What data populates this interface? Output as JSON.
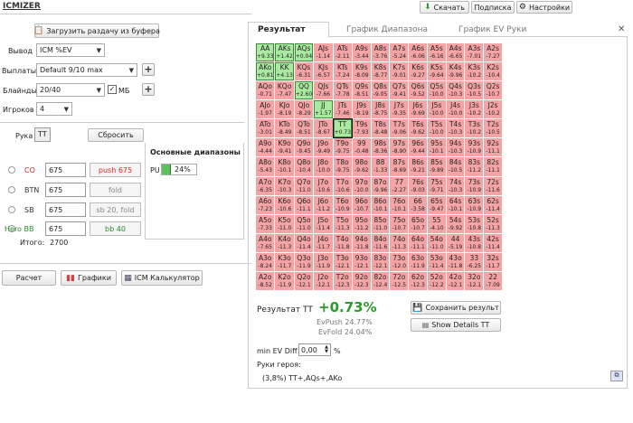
{
  "app": {
    "title": "ICMIZER"
  },
  "top_buttons": {
    "download": "Скачать",
    "subscribe": "Подписка",
    "settings": "Настройки"
  },
  "load_button": "Загрузить раздачу из буфера",
  "form": {
    "output_label": "Вывод",
    "output_value": "ICM %EV",
    "payouts_label": "Выплаты",
    "payouts_value": "Default 9/10 max",
    "blinds_label": "Блайнды",
    "blinds_value": "20/40",
    "mb_label": "МБ",
    "players_label": "Игроков",
    "players_value": "4"
  },
  "hand": {
    "label": "Рука",
    "value": "TT",
    "reset": "Сбросить"
  },
  "ranges": {
    "title": "Основные диапазоны",
    "pu_label": "PU",
    "pu_value": "24%"
  },
  "players": [
    {
      "pos": "CO",
      "stack": "675",
      "action": "push 675",
      "color": "#d22",
      "action_color": "#d22"
    },
    {
      "pos": "BTN",
      "stack": "675",
      "action": "fold",
      "color": "#333",
      "action_color": "#888"
    },
    {
      "pos": "SB",
      "stack": "675",
      "action": "sb 20, fold",
      "color": "#333",
      "action_color": "#888"
    },
    {
      "pos": "Hero BB",
      "stack": "675",
      "action": "bb 40",
      "color": "#2a8a2a",
      "action_color": "#2a8a2a"
    }
  ],
  "total": {
    "label": "Итого:",
    "value": "2700"
  },
  "bottom_buttons": {
    "calc": "Расчет",
    "charts": "Графики",
    "icm_calc": "ICM Калькулятор"
  },
  "tabs": [
    "Результат",
    "График Диапазона",
    "График EV Руки"
  ],
  "result": {
    "label": "Результат TT",
    "value": "+0.73%",
    "evpush": "EvPush 24.77%",
    "evfold": "EvFold 24.04%",
    "save": "Сохранить результ",
    "details": "Show Details TT",
    "min_ev_label": "min EV Diff",
    "min_ev_value": "0,00",
    "pct": "%",
    "hero_hands_label": "Руки героя:",
    "hero_hands": "(3,8%) TT+,AQs+,AKo"
  },
  "matrix": [
    [
      [
        "AA",
        "+9.33"
      ],
      [
        "AKs",
        "+1.42"
      ],
      [
        "AQs",
        "+0.04"
      ],
      [
        "AJs",
        "-1.14"
      ],
      [
        "ATs",
        "-2.11"
      ],
      [
        "A9s",
        "-3.44"
      ],
      [
        "A8s",
        "-3.76"
      ],
      [
        "A7s",
        "-5.24"
      ],
      [
        "A6s",
        "-6.06"
      ],
      [
        "A5s",
        "-6.16"
      ],
      [
        "A4s",
        "-6.65"
      ],
      [
        "A3s",
        "-7.01"
      ],
      [
        "A2s",
        "-7.27"
      ]
    ],
    [
      [
        "AKo",
        "+0.81"
      ],
      [
        "KK",
        "+4.13"
      ],
      [
        "KQs",
        "-6.31"
      ],
      [
        "KJs",
        "-6.57"
      ],
      [
        "KTs",
        "-7.24"
      ],
      [
        "K9s",
        "-8.09"
      ],
      [
        "K8s",
        "-8.77"
      ],
      [
        "K7s",
        "-9.01"
      ],
      [
        "K6s",
        "-9.27"
      ],
      [
        "K5s",
        "-9.64"
      ],
      [
        "K4s",
        "-9.96"
      ],
      [
        "K3s",
        "-10.2"
      ],
      [
        "K2s",
        "-10.4"
      ]
    ],
    [
      [
        "AQo",
        "-0.71"
      ],
      [
        "KQo",
        "-7.47"
      ],
      [
        "QQ",
        "+2.60"
      ],
      [
        "QJs",
        "-7.66"
      ],
      [
        "QTs",
        "-7.78"
      ],
      [
        "Q9s",
        "-8.51"
      ],
      [
        "Q8s",
        "-9.05"
      ],
      [
        "Q7s",
        "-9.41"
      ],
      [
        "Q6s",
        "-9.52"
      ],
      [
        "Q5s",
        "-10.0"
      ],
      [
        "Q4s",
        "-10.3"
      ],
      [
        "Q3s",
        "-10.5"
      ],
      [
        "Q2s",
        "-10.7"
      ]
    ],
    [
      [
        "AJo",
        "-1.97"
      ],
      [
        "KJo",
        "-8.19"
      ],
      [
        "QJo",
        "-8.29"
      ],
      [
        "JJ",
        "+1.57"
      ],
      [
        "JTs",
        "-7.46"
      ],
      [
        "J9s",
        "-8.19"
      ],
      [
        "J8s",
        "-8.75"
      ],
      [
        "J7s",
        "-9.35"
      ],
      [
        "J6s",
        "-9.69"
      ],
      [
        "J5s",
        "-10.0"
      ],
      [
        "J4s",
        "-10.0"
      ],
      [
        "J3s",
        "-10.2"
      ],
      [
        "J2s",
        "-10.2"
      ]
    ],
    [
      [
        "ATo",
        "-3.01"
      ],
      [
        "KTo",
        "-8.49"
      ],
      [
        "QTo",
        "-8.51"
      ],
      [
        "JTo",
        "-8.67"
      ],
      [
        "TT",
        "+0.73"
      ],
      [
        "T9s",
        "-7.93"
      ],
      [
        "T8s",
        "-8.48"
      ],
      [
        "T7s",
        "-9.06"
      ],
      [
        "T6s",
        "-9.62"
      ],
      [
        "T5s",
        "-10.0"
      ],
      [
        "T4s",
        "-10.3"
      ],
      [
        "T3s",
        "-10.2"
      ],
      [
        "T2s",
        "-10.5"
      ]
    ],
    [
      [
        "A9o",
        "-4.44"
      ],
      [
        "K9o",
        "-9.41"
      ],
      [
        "Q9o",
        "-9.45"
      ],
      [
        "J9o",
        "-9.49"
      ],
      [
        "T9o",
        "-9.75"
      ],
      [
        "99",
        "-0.48"
      ],
      [
        "98s",
        "-8.36"
      ],
      [
        "97s",
        "-8.90"
      ],
      [
        "96s",
        "-9.44"
      ],
      [
        "95s",
        "-10.1"
      ],
      [
        "94s",
        "-10.3"
      ],
      [
        "93s",
        "-10.9"
      ],
      [
        "92s",
        "-11.1"
      ]
    ],
    [
      [
        "A8o",
        "-5.43"
      ],
      [
        "K8o",
        "-10.1"
      ],
      [
        "Q8o",
        "-10.4"
      ],
      [
        "J8o",
        "-10.0"
      ],
      [
        "T8o",
        "-9.75"
      ],
      [
        "98o",
        "-9.62"
      ],
      [
        "88",
        "-1.33"
      ],
      [
        "87s",
        "-8.69"
      ],
      [
        "86s",
        "-9.21"
      ],
      [
        "85s",
        "-9.89"
      ],
      [
        "84s",
        "-10.5"
      ],
      [
        "83s",
        "-11.2"
      ],
      [
        "82s",
        "-11.1"
      ]
    ],
    [
      [
        "A7o",
        "-6.35"
      ],
      [
        "K7o",
        "-10.3"
      ],
      [
        "Q7o",
        "-11.0"
      ],
      [
        "J7o",
        "-10.6"
      ],
      [
        "T7o",
        "-10.6"
      ],
      [
        "97o",
        "-10.0"
      ],
      [
        "87o",
        "-9.96"
      ],
      [
        "77",
        "-2.27"
      ],
      [
        "76s",
        "-9.03"
      ],
      [
        "75s",
        "-9.71"
      ],
      [
        "74s",
        "-10.3"
      ],
      [
        "73s",
        "-10.9"
      ],
      [
        "72s",
        "-11.6"
      ]
    ],
    [
      [
        "A6o",
        "-7.23"
      ],
      [
        "K6o",
        "-10.6"
      ],
      [
        "Q6o",
        "-11.1"
      ],
      [
        "J6o",
        "-11.2"
      ],
      [
        "T6o",
        "-10.9"
      ],
      [
        "96o",
        "-10.7"
      ],
      [
        "86o",
        "-10.1"
      ],
      [
        "76o",
        "-10.1"
      ],
      [
        "66",
        "-3.58"
      ],
      [
        "65s",
        "-9.47"
      ],
      [
        "64s",
        "-10.1"
      ],
      [
        "63s",
        "-10.9"
      ],
      [
        "62s",
        "-11.4"
      ]
    ],
    [
      [
        "A5o",
        "-7.33"
      ],
      [
        "K5o",
        "-11.0"
      ],
      [
        "Q5o",
        "-11.0"
      ],
      [
        "J5o",
        "-11.4"
      ],
      [
        "T5o",
        "-11.3"
      ],
      [
        "95o",
        "-11.2"
      ],
      [
        "85o",
        "-11.0"
      ],
      [
        "75o",
        "-10.7"
      ],
      [
        "65o",
        "-10.7"
      ],
      [
        "55",
        "-4.10"
      ],
      [
        "54s",
        "-9.92"
      ],
      [
        "53s",
        "-10.8"
      ],
      [
        "52s",
        "-11.3"
      ]
    ],
    [
      [
        "A4o",
        "-7.65"
      ],
      [
        "K4o",
        "-11.3"
      ],
      [
        "Q4o",
        "-11.4"
      ],
      [
        "J4o",
        "-11.7"
      ],
      [
        "T4o",
        "-11.8"
      ],
      [
        "94o",
        "-11.8"
      ],
      [
        "84o",
        "-11.6"
      ],
      [
        "74o",
        "-11.3"
      ],
      [
        "64o",
        "-11.1"
      ],
      [
        "54o",
        "-11.0"
      ],
      [
        "44",
        "-5.19"
      ],
      [
        "43s",
        "-10.8"
      ],
      [
        "42s",
        "-11.4"
      ]
    ],
    [
      [
        "A3o",
        "-8.24"
      ],
      [
        "K3o",
        "-11.7"
      ],
      [
        "Q3o",
        "-11.9"
      ],
      [
        "J3o",
        "-11.9"
      ],
      [
        "T3o",
        "-12.1"
      ],
      [
        "93o",
        "-12.1"
      ],
      [
        "83o",
        "-12.1"
      ],
      [
        "73o",
        "-12.0"
      ],
      [
        "63o",
        "-11.9"
      ],
      [
        "53o",
        "-11.4"
      ],
      [
        "43o",
        "-11.8"
      ],
      [
        "33",
        "-6.25"
      ],
      [
        "32s",
        "-11.7"
      ]
    ],
    [
      [
        "A2o",
        "-8.52"
      ],
      [
        "K2o",
        "-11.9"
      ],
      [
        "Q2o",
        "-12.1"
      ],
      [
        "J2o",
        "-12.1"
      ],
      [
        "T2o",
        "-12.3"
      ],
      [
        "92o",
        "-12.3"
      ],
      [
        "82o",
        "-12.4"
      ],
      [
        "72o",
        "-12.5"
      ],
      [
        "62o",
        "-12.3"
      ],
      [
        "52o",
        "-12.2"
      ],
      [
        "42o",
        "-12.1"
      ],
      [
        "32o",
        "-12.1"
      ],
      [
        "22",
        "-7.09"
      ]
    ]
  ]
}
